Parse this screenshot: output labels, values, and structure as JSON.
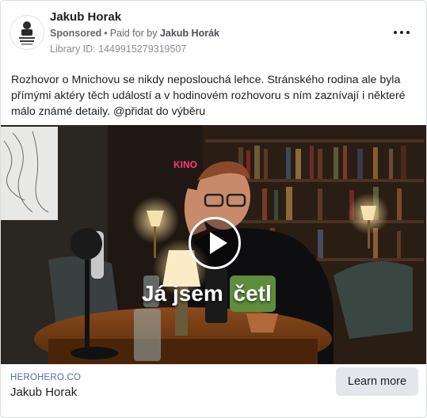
{
  "post": {
    "page_name": "Jakub Horak",
    "sponsored_label": "Sponsored",
    "separator": "•",
    "paid_for_label": "Paid for by",
    "payer_name": "Jakub Horák",
    "library_id": "Library ID: 1449915279319507",
    "text": "Rozhovor o Mnichovu se nikdy neposlouchá lehce. Stránského rodina ale byla přímými aktéry těch událostí a v hodinovém rozhovoru s ním zaznívají i některé málo známé detaily. @přidat do výběru",
    "avatar_icon": "brand-logo-icon",
    "more_icon": "more-options-icon"
  },
  "video": {
    "caption_part1": "Já jsem",
    "caption_part2": "četl",
    "caption_highlight_color": "#5e8d3c",
    "neon_sign": "KINO",
    "play_icon": "play-icon"
  },
  "footer": {
    "domain": "HEROHERO.CO",
    "title": "Jakub Horak",
    "cta_label": "Learn more"
  }
}
